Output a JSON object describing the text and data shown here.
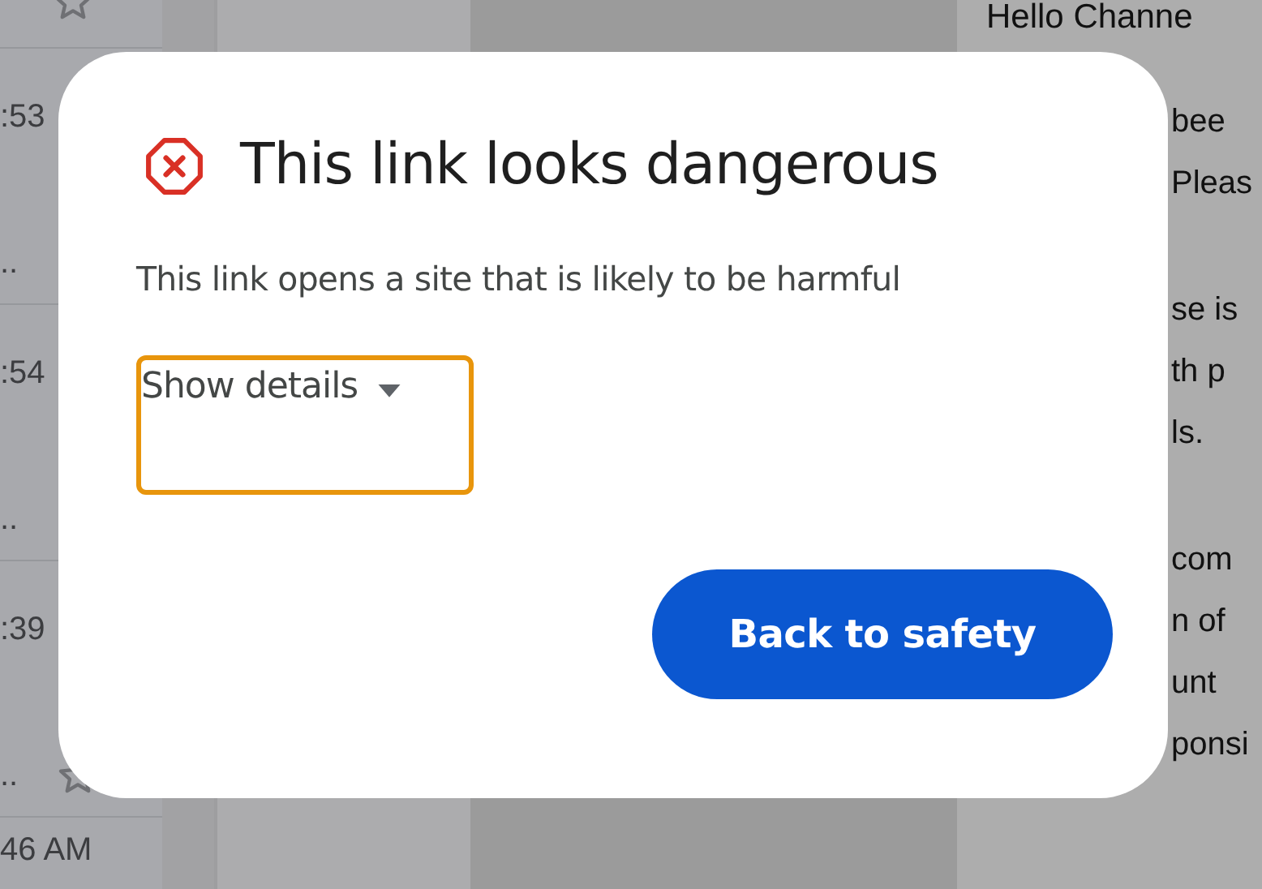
{
  "background": {
    "message_list": {
      "rows": [
        {
          "time": ":53",
          "snippet": ".."
        },
        {
          "time": ":54",
          "snippet": ".."
        },
        {
          "time": ":39",
          "snippet": ".."
        }
      ],
      "next_time": "46 AM"
    },
    "message_body": {
      "greeting": "Hello Channe",
      "paragraphs": [
        [
          "bee",
          "Pleas"
        ],
        [
          "se is",
          "th p",
          "ls."
        ],
        [
          "com",
          "n of",
          "unt",
          "ponsi"
        ]
      ]
    }
  },
  "dialog": {
    "title": "This link looks dangerous",
    "description": "This link opens a site that is likely to be harmful",
    "details_toggle": {
      "label": "Show details",
      "expanded": false,
      "focused": true
    },
    "button": "Back to safety"
  }
}
